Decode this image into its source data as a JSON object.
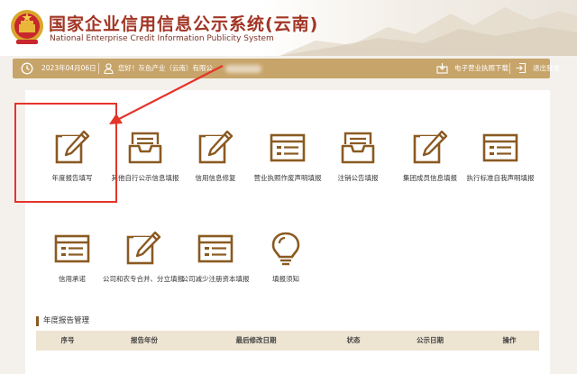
{
  "header": {
    "title": "国家企业信用信息公示系统(云南)",
    "subtitle": "National Enterprise Credit Information Publicity System",
    "emblem_icon": "national-emblem-icon"
  },
  "topbar": {
    "date": "2023年04月06日",
    "greeting": "您好！灰色产业（云南）有限公",
    "download_label": "电子营业执照下载",
    "logout_label": "退出登录",
    "icons": [
      "clock-icon",
      "user-icon",
      "download-icon",
      "logout-icon"
    ]
  },
  "tiles": [
    {
      "label": "年度报告填写",
      "icon": "edit-icon"
    },
    {
      "label": "其他自行公示信息填报",
      "icon": "inbox-tray-icon"
    },
    {
      "label": "信用信息修复",
      "icon": "edit-icon"
    },
    {
      "label": "营业执照作废声明填报",
      "icon": "form-list-icon"
    },
    {
      "label": "注销公告填报",
      "icon": "inbox-tray-icon"
    },
    {
      "label": "集团成员信息填报",
      "icon": "edit-icon"
    },
    {
      "label": "执行标准自我声明填报",
      "icon": "form-list-icon"
    },
    {
      "label": "信用承诺",
      "icon": "form-list-icon"
    },
    {
      "label": "公司和农专合并、分立填报",
      "icon": "edit-icon"
    },
    {
      "label": "公司减少注册资本填报",
      "icon": "form-list-icon"
    },
    {
      "label": "填报须知",
      "icon": "lightbulb-icon"
    }
  ],
  "annual_section": {
    "title": "年度报告管理",
    "columns": [
      "序号",
      "报告年份",
      "最后修改日期",
      "状态",
      "公示日期",
      "操作"
    ]
  },
  "colors": {
    "brand_red": "#a23524",
    "gold": "#c7a46a",
    "icon_brown": "#8a5a22",
    "table_header": "#eee4d2",
    "annotation_red": "#e5342a"
  }
}
